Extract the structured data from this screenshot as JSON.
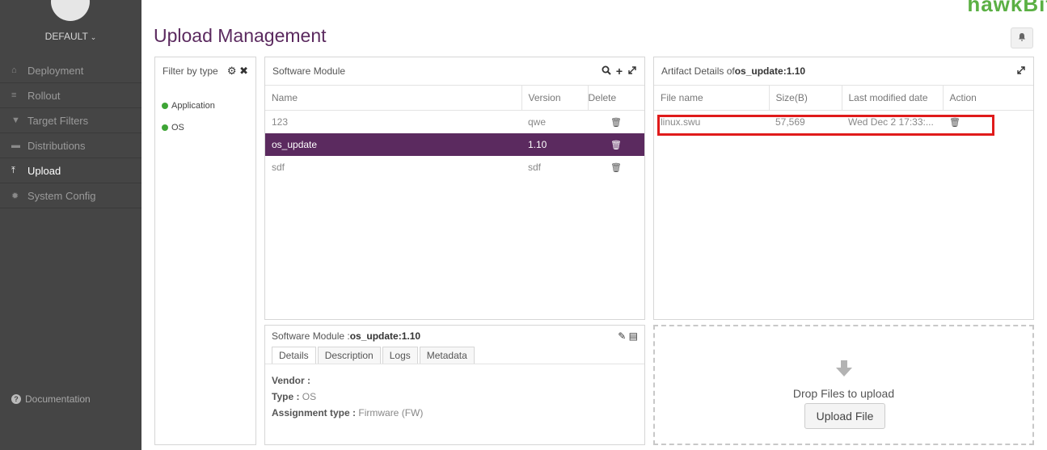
{
  "sidebar": {
    "tenant": "DEFAULT",
    "items": [
      {
        "label": "Deployment",
        "icon": "home-icon"
      },
      {
        "label": "Rollout",
        "icon": "list-icon"
      },
      {
        "label": "Target Filters",
        "icon": "filter-icon"
      },
      {
        "label": "Distributions",
        "icon": "archive-icon"
      },
      {
        "label": "Upload",
        "icon": "upload-icon"
      },
      {
        "label": "System Config",
        "icon": "gear-icon"
      }
    ],
    "active": "Upload",
    "documentation": "Documentation"
  },
  "header": {
    "title": "Upload Management",
    "logo": "hawkBit"
  },
  "filter": {
    "title": "Filter by type",
    "types": [
      {
        "label": "Application",
        "color": "#3ea536"
      },
      {
        "label": "OS",
        "color": "#3ea536"
      }
    ]
  },
  "software_module": {
    "title": "Software Module",
    "columns": [
      "Name",
      "Version",
      "Delete"
    ],
    "rows": [
      {
        "name": "123",
        "version": "qwe"
      },
      {
        "name": "os_update",
        "version": "1.10",
        "selected": true
      },
      {
        "name": "sdf",
        "version": "sdf"
      }
    ]
  },
  "artifact": {
    "title_prefix": "Artifact Details of ",
    "title_module": "os_update:1.10",
    "columns": [
      "File name",
      "Size(B)",
      "Last modified date",
      "Action"
    ],
    "rows": [
      {
        "file": "linux.swu",
        "size": "57,569",
        "modified": "Wed Dec 2 17:33:..."
      }
    ]
  },
  "details": {
    "title_prefix": "Software Module : ",
    "title_module": "os_update:1.10",
    "tabs": [
      "Details",
      "Description",
      "Logs",
      "Metadata"
    ],
    "active_tab": "Details",
    "vendor_label": "Vendor :",
    "vendor_value": "",
    "type_label": "Type :",
    "type_value": "OS",
    "assignment_label": "Assignment type :",
    "assignment_value": "Firmware (FW)"
  },
  "upload": {
    "drop_text": "Drop Files to upload",
    "button": "Upload File"
  },
  "colors": {
    "accent": "#5b2a5f",
    "sidebar": "#454545",
    "type_dot": "#3ea536",
    "highlight": "#e01b1b"
  }
}
